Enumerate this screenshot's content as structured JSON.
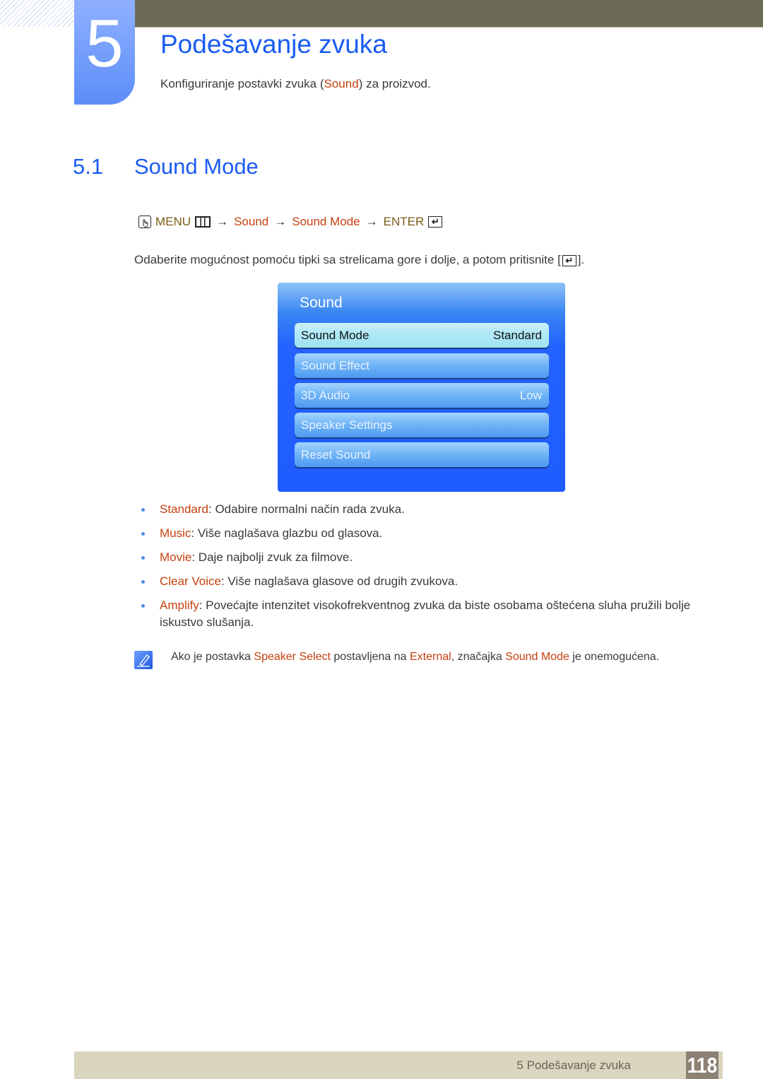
{
  "chapter": {
    "number": "5",
    "title": "Podešavanje zvuka",
    "subtitle_before": "Konfiguriranje postavki zvuka (",
    "subtitle_highlight": "Sound",
    "subtitle_after": ") za proizvod."
  },
  "section": {
    "number": "5.1",
    "title": "Sound Mode"
  },
  "menu_path": {
    "menu_label": "MENU",
    "arrow": "→",
    "step1": "Sound",
    "step2": "Sound Mode",
    "enter_label": "ENTER",
    "icons": [
      "remote-hand-icon",
      "menu-grid-icon",
      "enter-icon"
    ]
  },
  "instruction": {
    "text": "Odaberite mogućnost pomoću tipki sa strelicama gore i dolje, a potom pritisnite [",
    "close": "]."
  },
  "tv_menu": {
    "title": "Sound",
    "items": [
      {
        "label": "Sound Mode",
        "value": "Standard",
        "selected": true
      },
      {
        "label": "Sound Effect",
        "value": ""
      },
      {
        "label": "3D Audio",
        "value": "Low"
      },
      {
        "label": "Speaker Settings",
        "value": ""
      },
      {
        "label": "Reset Sound",
        "value": ""
      }
    ]
  },
  "options": [
    {
      "term": "Standard",
      "desc": ": Odabire normalni način rada zvuka."
    },
    {
      "term": "Music",
      "desc": ": Više naglašava glazbu od glasova."
    },
    {
      "term": "Movie",
      "desc": ": Daje najbolji zvuk za filmove."
    },
    {
      "term": "Clear Voice",
      "desc": ": Više naglašava glasove od drugih zvukova."
    },
    {
      "term": "Amplify",
      "desc": ": Povećajte intenzitet visokofrekventnog zvuka da biste osobama oštećena sluha pružili bolje iskustvo slušanja."
    }
  ],
  "note": {
    "t1": "Ako je postavka ",
    "h1": "Speaker Select",
    "t2": " postavljena na ",
    "h2": "External",
    "t3": ", značajka ",
    "h3": "Sound Mode",
    "t4": " je onemogućena."
  },
  "footer": {
    "chapter_label": "5 Podešavanje zvuka",
    "page_number": "118"
  },
  "colors": {
    "heading_blue": "#1a5cf2",
    "highlight_orange": "#c4400e",
    "menu_gold": "#7a5c14",
    "top_bar": "#6d6b58",
    "footer_bar": "#d9d5bf",
    "page_badge": "#8c8174"
  }
}
